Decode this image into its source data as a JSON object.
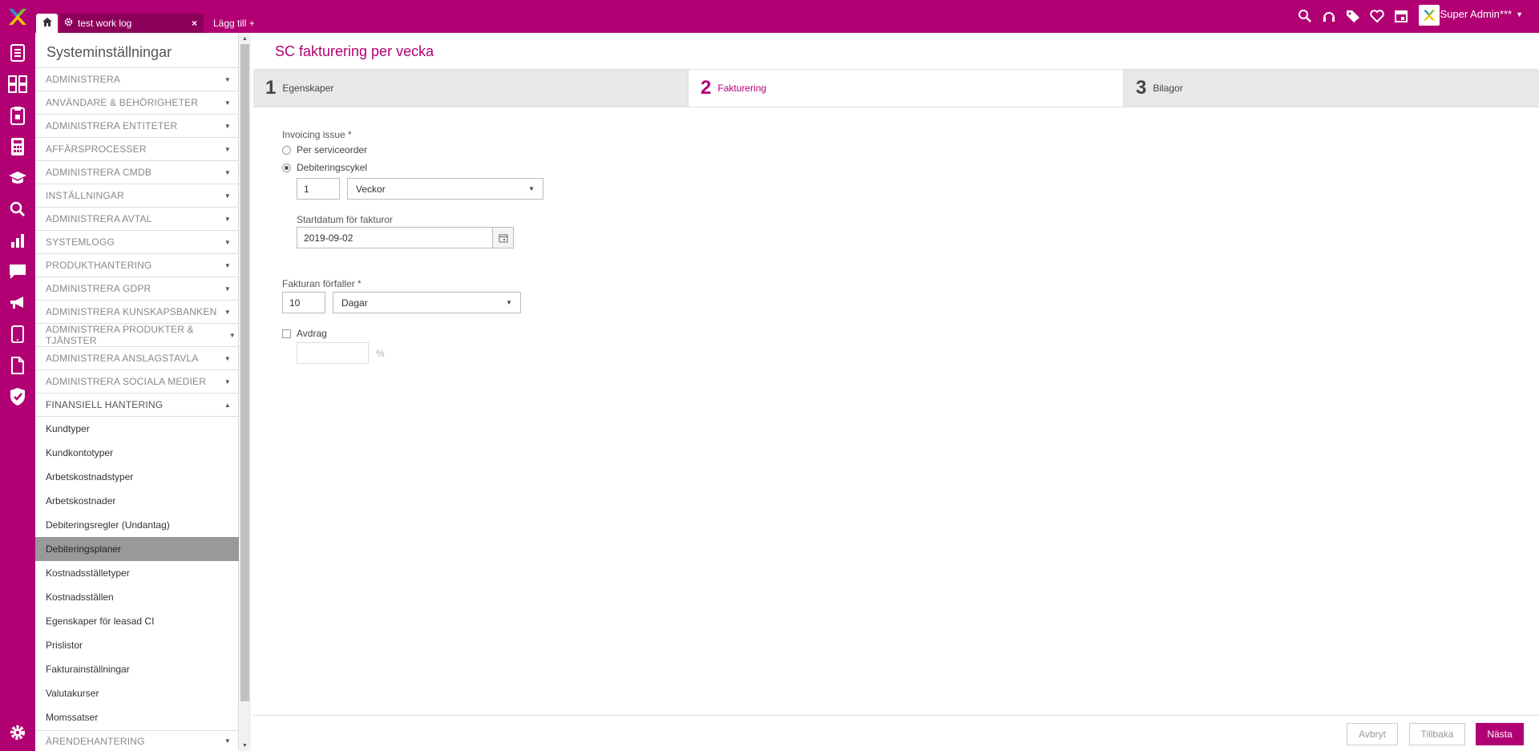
{
  "topbar": {
    "tabs": [
      {
        "label": "test work log",
        "close": "×"
      },
      {
        "label": "Lägg till +"
      }
    ],
    "user": "Super Admin***"
  },
  "sidebar": {
    "title": "Systeminställningar",
    "sections": [
      {
        "label": "ADMINISTRERA"
      },
      {
        "label": "ANVÄNDARE & BEHÖRIGHETER"
      },
      {
        "label": "ADMINISTRERA ENTITETER"
      },
      {
        "label": "AFFÄRSPROCESSER"
      },
      {
        "label": "ADMINISTRERA CMDB"
      },
      {
        "label": "INSTÄLLNINGAR"
      },
      {
        "label": "ADMINISTRERA AVTAL"
      },
      {
        "label": "SYSTEMLOGG"
      },
      {
        "label": "PRODUKTHANTERING"
      },
      {
        "label": "ADMINISTRERA GDPR"
      },
      {
        "label": "ADMINISTRERA KUNSKAPSBANKEN"
      },
      {
        "label": "ADMINISTRERA PRODUKTER & TJÄNSTER"
      },
      {
        "label": "ADMINISTRERA ANSLAGSTAVLA"
      },
      {
        "label": "ADMINISTRERA SOCIALA MEDIER"
      },
      {
        "label": "FINANSIELL HANTERING"
      }
    ],
    "items": [
      {
        "label": "Kundtyper"
      },
      {
        "label": "Kundkontotyper"
      },
      {
        "label": "Arbetskostnadstyper"
      },
      {
        "label": "Arbetskostnader"
      },
      {
        "label": "Debiteringsregler (Undantag)"
      },
      {
        "label": "Debiteringsplaner"
      },
      {
        "label": "Kostnadsställetyper"
      },
      {
        "label": "Kostnadsställen"
      },
      {
        "label": "Egenskaper för leasad CI"
      },
      {
        "label": "Prislistor"
      },
      {
        "label": "Fakturainställningar"
      },
      {
        "label": "Valutakurser"
      },
      {
        "label": "Momssatser"
      }
    ],
    "bottom_section": "ÄRENDEHANTERING"
  },
  "main": {
    "title": "SC fakturering per vecka",
    "steps": [
      {
        "num": "1",
        "label": "Egenskaper"
      },
      {
        "num": "2",
        "label": "Fakturering"
      },
      {
        "num": "3",
        "label": "Bilagor"
      }
    ],
    "form": {
      "invoicing_issue_label": "Invoicing issue *",
      "option_per_serviceorder": "Per serviceorder",
      "option_debiteringscykel": "Debiteringscykel",
      "cycle_value": "1",
      "cycle_unit": "Veckor",
      "startdate_label": "Startdatum för fakturor",
      "startdate_value": "2019-09-02",
      "due_label": "Fakturan förfaller *",
      "due_value": "10",
      "due_unit": "Dagar",
      "avdrag_label": "Avdrag",
      "percent_suffix": "%"
    },
    "footer": {
      "cancel": "Avbryt",
      "back": "Tillbaka",
      "next": "Nästa"
    }
  }
}
